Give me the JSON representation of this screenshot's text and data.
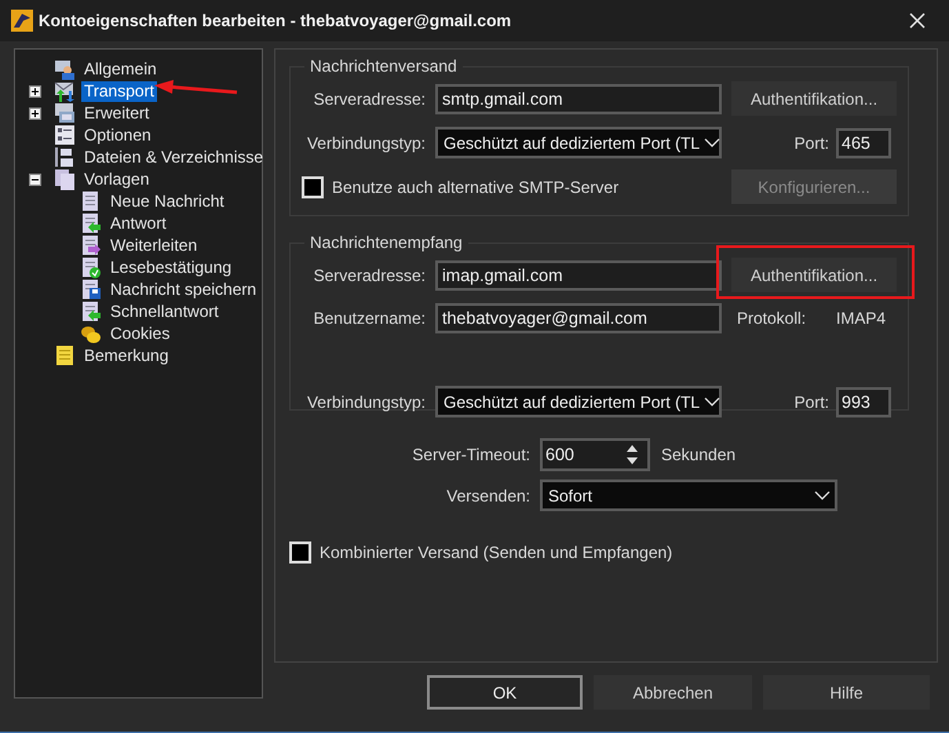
{
  "window": {
    "title": "Kontoeigenschaften bearbeiten - thebatvoyager@gmail.com"
  },
  "tree": [
    {
      "label": "Allgemein",
      "selected": false,
      "expandable": false
    },
    {
      "label": "Transport",
      "selected": true,
      "expandable": true,
      "expanded": false
    },
    {
      "label": "Erweitert",
      "selected": false,
      "expandable": true,
      "expanded": false
    },
    {
      "label": "Optionen",
      "selected": false,
      "expandable": false
    },
    {
      "label": "Dateien & Verzeichnisse",
      "selected": false,
      "expandable": false
    },
    {
      "label": "Vorlagen",
      "selected": false,
      "expandable": true,
      "expanded": true,
      "children": [
        {
          "label": "Neue Nachricht",
          "selected": false
        },
        {
          "label": "Antwort",
          "selected": false
        },
        {
          "label": "Weiterleiten",
          "selected": false
        },
        {
          "label": "Lesebestätigung",
          "selected": false
        },
        {
          "label": "Nachricht speichern",
          "selected": false
        },
        {
          "label": "Schnellantwort",
          "selected": false
        },
        {
          "label": "Cookies",
          "selected": false
        }
      ]
    },
    {
      "label": "Bemerkung",
      "selected": false,
      "expandable": false
    }
  ],
  "sending": {
    "title": "Nachrichtenversand",
    "server_label": "Serveradresse:",
    "server": "smtp.gmail.com",
    "auth_button": "Authentifikation...",
    "conn_label": "Verbindungstyp:",
    "conn": "Geschützt auf dediziertem Port (TL",
    "port_label": "Port:",
    "port": "465",
    "alt_checkbox": {
      "label": "Benutze auch alternative SMTP-Server",
      "checked": false
    },
    "config_button": {
      "label": "Konfigurieren...",
      "disabled": true
    }
  },
  "receiving": {
    "title": "Nachrichtenempfang",
    "server_label": "Serveradresse:",
    "server": "imap.gmail.com",
    "auth_button": "Authentifikation...",
    "user_label": "Benutzername:",
    "user": "thebatvoyager@gmail.com",
    "protocol_label": "Protokoll:",
    "protocol": "IMAP4",
    "conn_label": "Verbindungstyp:",
    "conn": "Geschützt auf dediziertem Port (TL",
    "port_label": "Port:",
    "port": "993"
  },
  "timeout": {
    "label": "Server-Timeout:",
    "value": "600",
    "unit": "Sekunden"
  },
  "send_mode": {
    "label": "Versenden:",
    "value": "Sofort"
  },
  "combined_checkbox": {
    "label": "Kombinierter Versand (Senden und Empfangen)",
    "checked": false
  },
  "buttons": [
    {
      "label": "OK",
      "default": true
    },
    {
      "label": "Abbrechen",
      "default": false
    },
    {
      "label": "Hilfe",
      "default": false
    }
  ],
  "arrow_annotation": {
    "color": "#e8191c"
  },
  "highlight_annotation": {
    "color": "#e8191c"
  }
}
